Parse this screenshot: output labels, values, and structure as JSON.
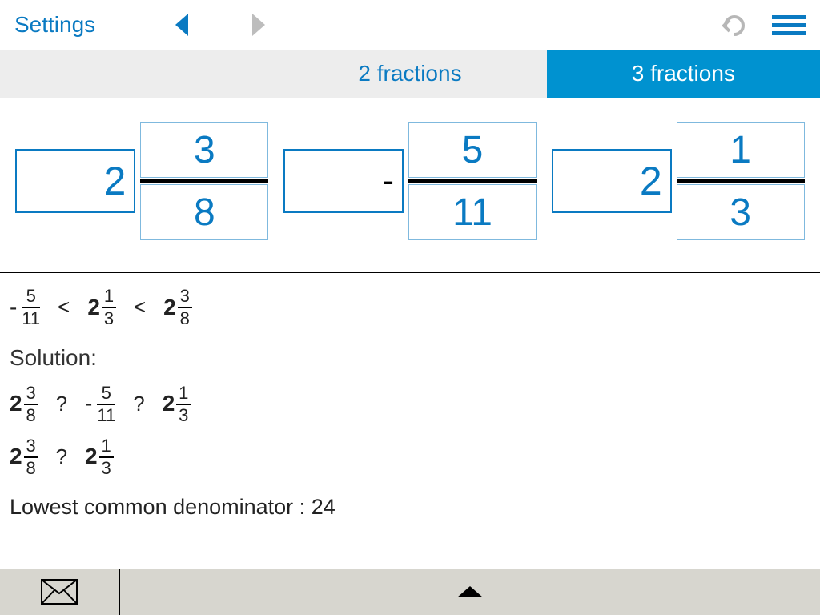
{
  "topbar": {
    "settings_label": "Settings"
  },
  "tabs": {
    "two": "2 fractions",
    "three": "3 fractions"
  },
  "inputs": {
    "a": {
      "whole": "2",
      "num": "3",
      "den": "8"
    },
    "b": {
      "whole": "-",
      "num": "5",
      "den": "11"
    },
    "c": {
      "whole": "2",
      "num": "1",
      "den": "3"
    }
  },
  "answer": {
    "terms": [
      {
        "sign": "-",
        "whole": "",
        "num": "5",
        "den": "11"
      },
      {
        "sign": "",
        "whole": "2",
        "num": "1",
        "den": "3"
      },
      {
        "sign": "",
        "whole": "2",
        "num": "3",
        "den": "8"
      }
    ],
    "cmp": "<"
  },
  "solution": {
    "label": "Solution:",
    "line1": {
      "t1": {
        "sign": "",
        "whole": "2",
        "num": "3",
        "den": "8"
      },
      "op1": "?",
      "t2": {
        "sign": "-",
        "whole": "",
        "num": "5",
        "den": "11"
      },
      "op2": "?",
      "t3": {
        "sign": "",
        "whole": "2",
        "num": "1",
        "den": "3"
      }
    },
    "line2": {
      "t1": {
        "sign": "",
        "whole": "2",
        "num": "3",
        "den": "8"
      },
      "op1": "?",
      "t2": {
        "sign": "",
        "whole": "2",
        "num": "1",
        "den": "3"
      }
    },
    "lcd_label": "Lowest common denominator : ",
    "lcd_value": "24"
  }
}
